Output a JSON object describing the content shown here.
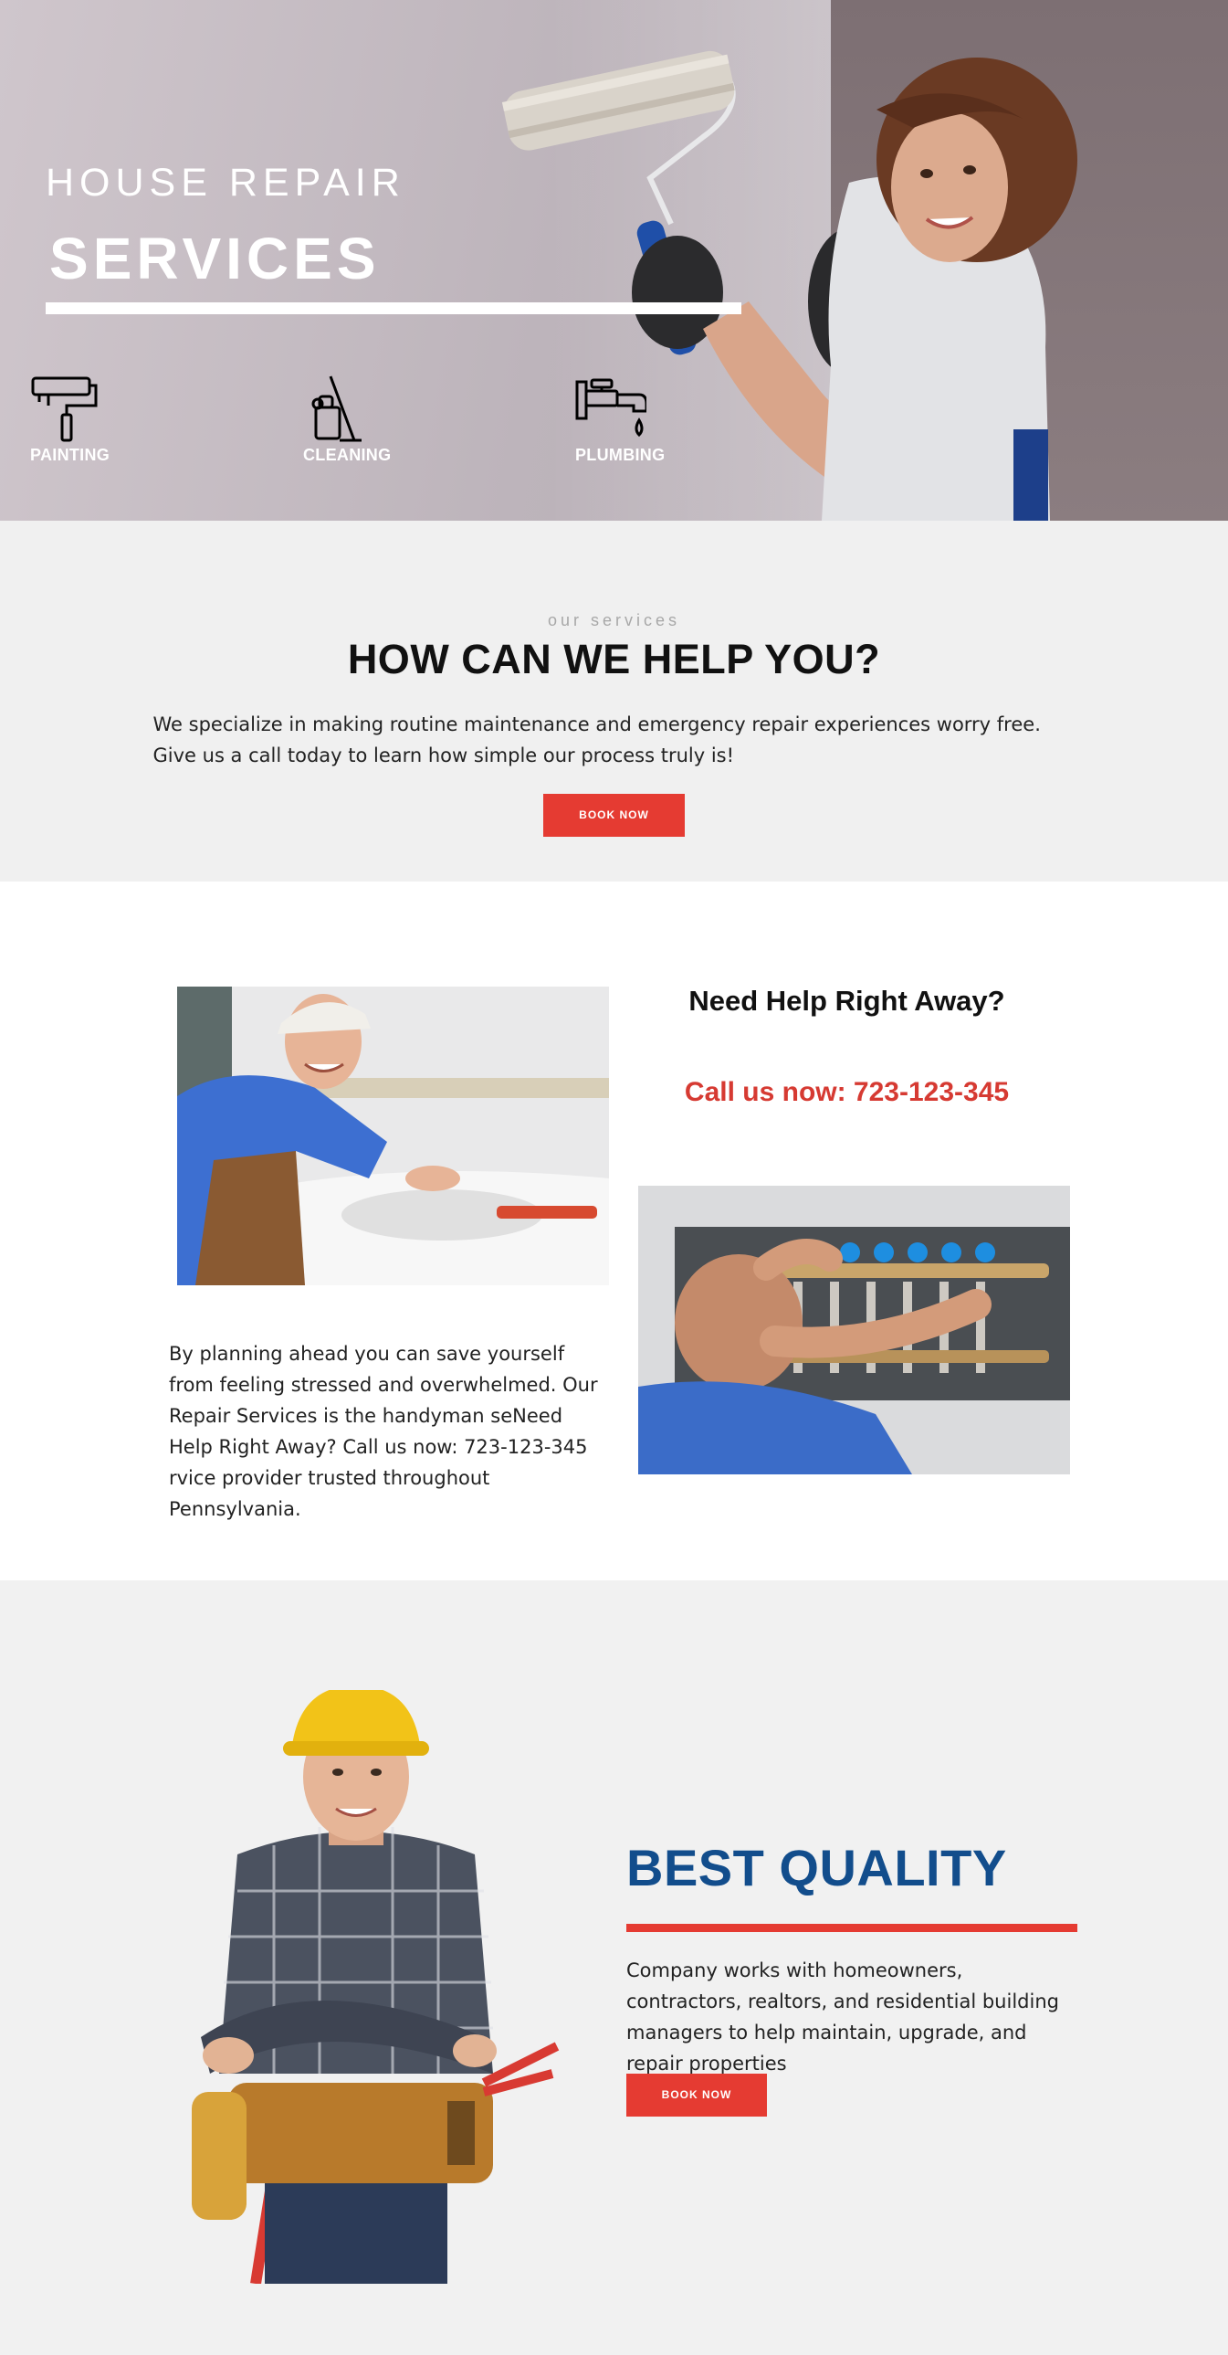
{
  "hero": {
    "title_line1": "HOUSE REPAIR",
    "title_line2": "SERVICES",
    "services": [
      {
        "label": "PAINTING",
        "icon": "paint-roller-icon"
      },
      {
        "label": "CLEANING",
        "icon": "cleaning-bucket-icon"
      },
      {
        "label": "PLUMBING",
        "icon": "faucet-icon"
      }
    ]
  },
  "help": {
    "eyebrow": "our services",
    "title": "HOW CAN WE HELP YOU?",
    "text": "We specialize in making routine maintenance and emergency repair experiences worry free. Give us a call today to learn how simple our process truly is!",
    "button": "BOOK NOW"
  },
  "call": {
    "heading": "Need Help Right Away?",
    "phone_line": "Call us now: 723-123-345",
    "body": "By planning ahead you can save yourself from feeling stressed and overwhelmed. Our Repair Services is the handyman seNeed Help Right Away? Call us now: 723-123-345 rvice provider trusted throughout Pennsylvania."
  },
  "quality": {
    "title": "BEST QUALITY",
    "text": "Company works with homeowners, contractors, realtors, and residential building managers to help maintain, upgrade, and repair properties",
    "button": "BOOK NOW"
  },
  "colors": {
    "accent_red": "#e53b32",
    "brand_blue": "#124d8c",
    "call_red": "#d63a32",
    "section_gray": "#f0f0f0"
  }
}
